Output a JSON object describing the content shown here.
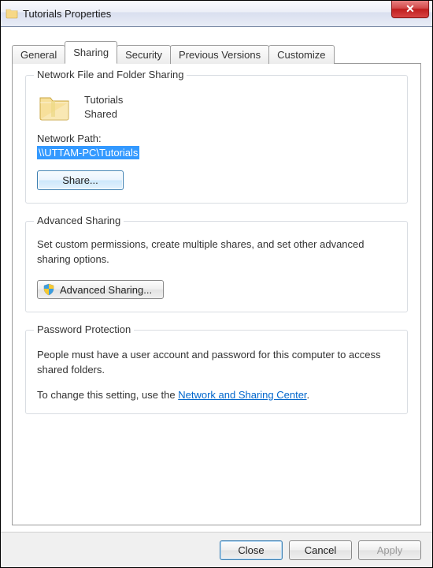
{
  "window": {
    "title": "Tutorials Properties"
  },
  "tabs": [
    "General",
    "Sharing",
    "Security",
    "Previous Versions",
    "Customize"
  ],
  "active_tab_index": 1,
  "group_network": {
    "title": "Network File and Folder Sharing",
    "item_name": "Tutorials",
    "item_status": "Shared",
    "path_label": "Network Path:",
    "path_value": "\\\\UTTAM-PC\\Tutorials",
    "share_button": "Share..."
  },
  "group_advanced": {
    "title": "Advanced Sharing",
    "description": "Set custom permissions, create multiple shares, and set other advanced sharing options.",
    "button": "Advanced Sharing..."
  },
  "group_password": {
    "title": "Password Protection",
    "line1": "People must have a user account and password for this computer to access shared folders.",
    "line2_prefix": "To change this setting, use the ",
    "line2_link": "Network and Sharing Center",
    "line2_suffix": "."
  },
  "buttons": {
    "close": "Close",
    "cancel": "Cancel",
    "apply": "Apply"
  }
}
